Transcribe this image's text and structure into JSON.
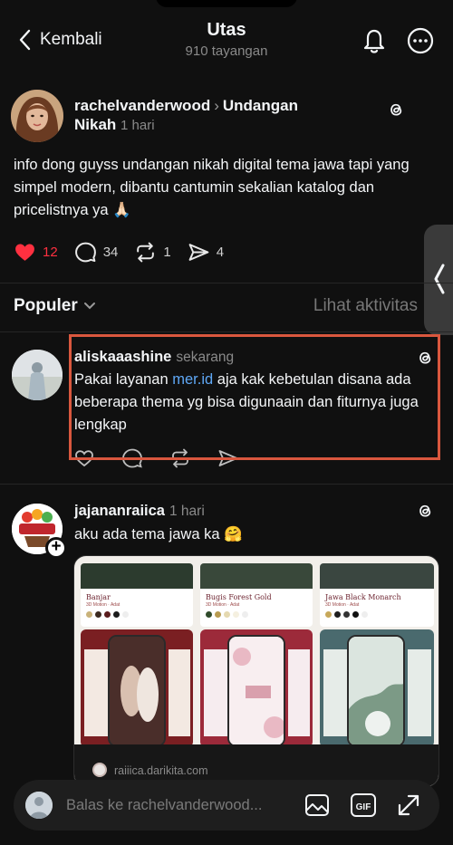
{
  "header": {
    "back_label": "Kembali",
    "title": "Utas",
    "views": "910 tayangan"
  },
  "post": {
    "username": "rachelvanderwood",
    "topic": "Undangan Nikah",
    "time": "1 hari",
    "text": "info dong guyss undangan nikah digital tema jawa tapi yang simpel modern, dibantu cantumin sekalian katalog dan pricelistnya ya 🙏🏻",
    "likes": "12",
    "comments": "34",
    "reposts": "1",
    "shares": "4"
  },
  "sort": {
    "label": "Populer",
    "activity": "Lihat aktivitas"
  },
  "comments": [
    {
      "username": "aliskaaashine",
      "time": "sekarang",
      "text_before": "Pakai layanan ",
      "link": "mer.id",
      "text_after": " aja kak kebetulan disana ada beberapa thema yg bisa digunaain dan fiturnya juga lengkap"
    },
    {
      "username": "jajananraiica",
      "time": "1 hari",
      "text": "aku ada tema jawa ka 🤗",
      "preview_templates": [
        {
          "name": "Banjar",
          "sub": "3D Motion · Adat"
        },
        {
          "name": "Bugis Forest Gold",
          "sub": "3D Motion · Adat"
        },
        {
          "name": "Jawa Black Monarch",
          "sub": "3D Motion · Adat"
        }
      ],
      "preview_domain": "raiiica.darikita.com"
    }
  ],
  "reply": {
    "placeholder": "Balas ke rachelvanderwood..."
  },
  "colors": {
    "background": "#101010",
    "like_red": "#ff3040",
    "link_blue": "#5fa8f6",
    "highlight_box": "#d9573e"
  }
}
